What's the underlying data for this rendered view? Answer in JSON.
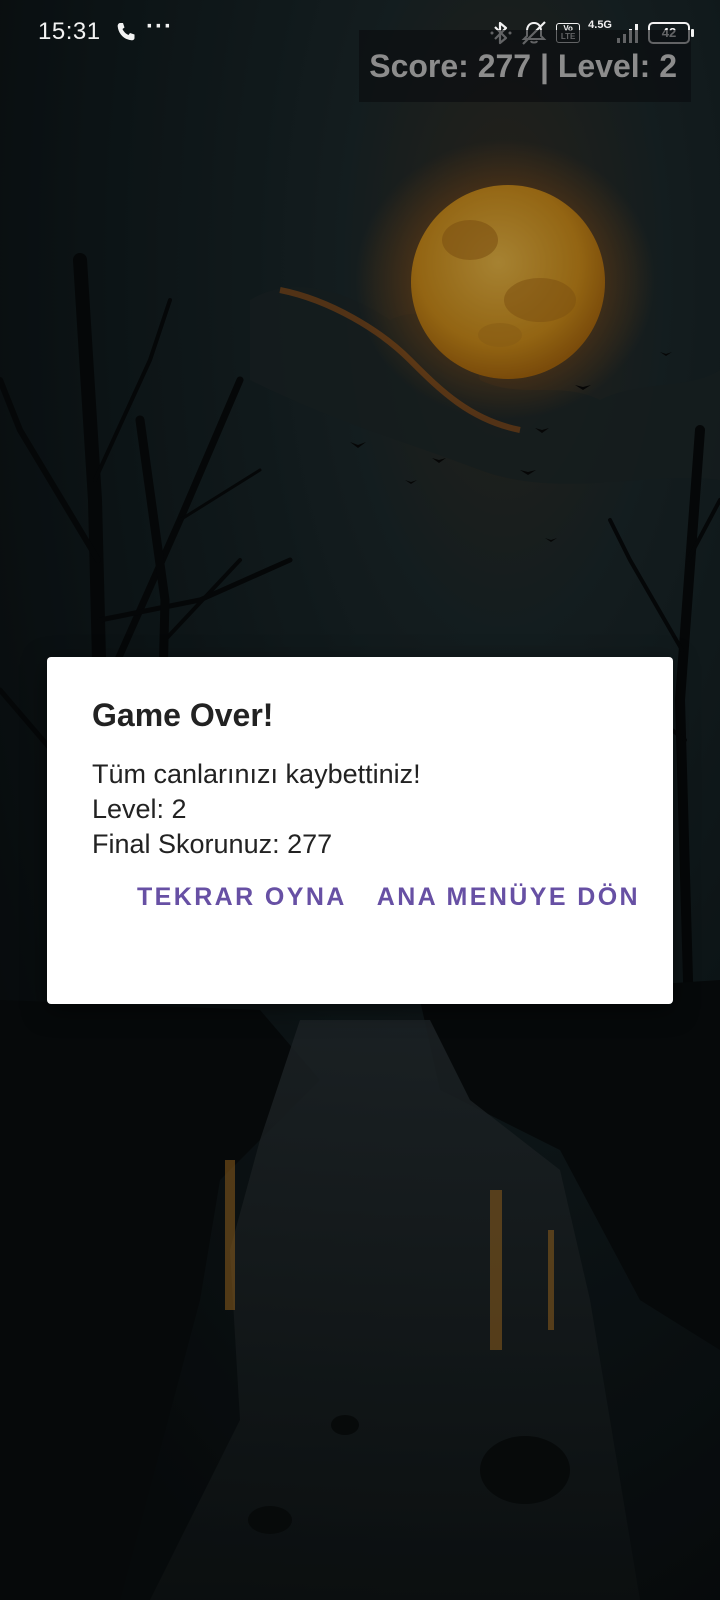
{
  "status_bar": {
    "time": "15:31",
    "more_indicator": "···",
    "icons": [
      "phone-call-icon",
      "bluetooth-icon",
      "muted-bell-icon",
      "volte-icon",
      "signal-icon",
      "battery-icon"
    ],
    "volte_label": "Vo LTE",
    "network_label": "4.5G",
    "battery_level": "42"
  },
  "hud": {
    "score_text": "Score: 277 | Level: 2"
  },
  "dialog": {
    "title": "Game Over!",
    "lines": [
      "Tüm canlarınızı kaybettiniz!",
      "Level: 2",
      "Final Skorunuz: 277"
    ],
    "buttons": {
      "play_again": "TEKRAR OYNA",
      "main_menu": "ANA MENÜYE DÖN"
    }
  },
  "colors": {
    "accent": "#6750a4",
    "moon": "#e0a526",
    "sky": "#17262b"
  }
}
